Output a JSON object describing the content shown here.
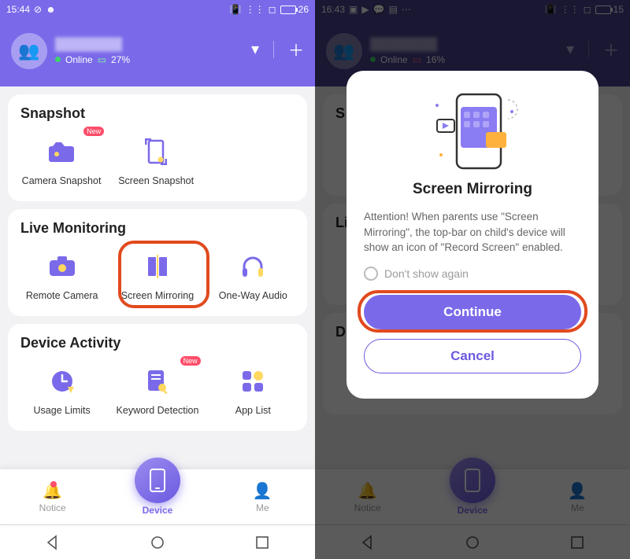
{
  "left": {
    "status": {
      "time": "15:44",
      "battery": "26"
    },
    "header": {
      "online": "Online",
      "battery": "27%"
    },
    "sections": {
      "snapshot": {
        "title": "Snapshot",
        "items": [
          "Camera Snapshot",
          "Screen Snapshot"
        ]
      },
      "live": {
        "title": "Live Monitoring",
        "items": [
          "Remote Camera",
          "Screen Mirroring",
          "One-Way Audio"
        ]
      },
      "activity": {
        "title": "Device Activity",
        "items": [
          "Usage Limits",
          "Keyword Detection",
          "App List"
        ]
      }
    },
    "nav": {
      "notice": "Notice",
      "device": "Device",
      "me": "Me"
    }
  },
  "right": {
    "status": {
      "time": "16:43",
      "battery": "15"
    },
    "header": {
      "online": "Online",
      "battery": "16%"
    },
    "modal": {
      "title": "Screen Mirroring",
      "body": "Attention! When parents use \"Screen Mirroring\", the top-bar on child's device will show an icon of \"Record Screen\" enabled.",
      "dontshow": "Don't show again",
      "continue": "Continue",
      "cancel": "Cancel"
    }
  }
}
